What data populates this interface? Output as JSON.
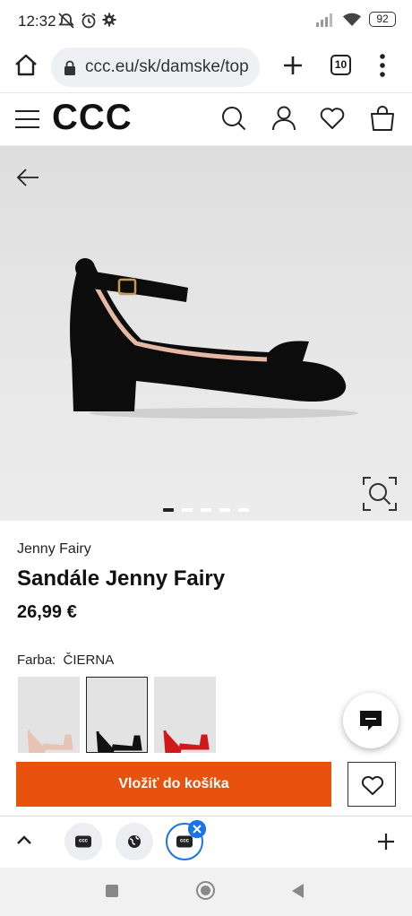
{
  "status_bar": {
    "time": "12:32",
    "battery": "92"
  },
  "browser": {
    "url": "ccc.eu/sk/damske/top",
    "tab_count": "10"
  },
  "site": {
    "logo": "CCC"
  },
  "product": {
    "brand": "Jenny Fairy",
    "title": "Sandále Jenny Fairy",
    "price": "26,99 €",
    "color_label": "Farba:",
    "color_value": "ČIERNA",
    "add_to_cart": "Vložiť do košíka",
    "image_count": 5,
    "active_image_index": 0,
    "swatch_colors": [
      "#e8c2b2",
      "#111111",
      "#d21919"
    ]
  },
  "tab_strip": {
    "favicon_text": "ccc"
  }
}
